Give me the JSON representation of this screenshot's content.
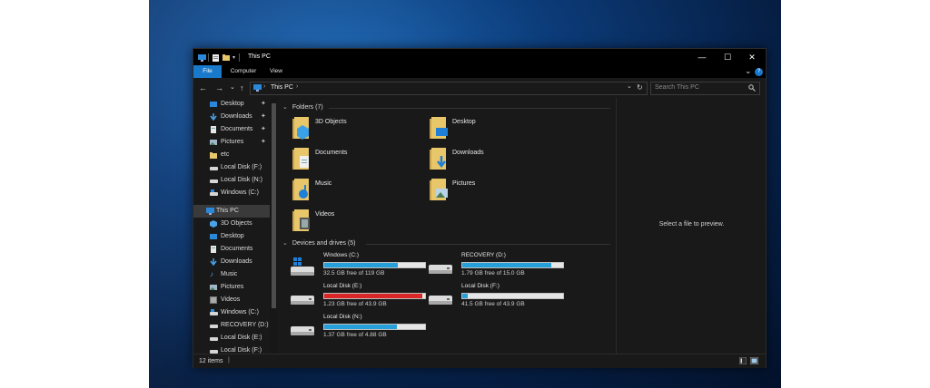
{
  "window": {
    "title": "This PC",
    "controls": {
      "minimize": "—",
      "maximize": "☐",
      "close": "✕"
    },
    "help": "?"
  },
  "quick_access": {
    "dropdown": "▾"
  },
  "ribbon": {
    "tabs": [
      "File",
      "Computer",
      "View"
    ],
    "expand": "⌄"
  },
  "nav": {
    "back": "←",
    "forward": "→",
    "recent": "⌄",
    "up": "↑",
    "address": {
      "crumb": "This PC",
      "sep1": "›",
      "sep2": "›"
    },
    "dropdown": "⌄",
    "refresh": "↻",
    "search_placeholder": "Search This PC"
  },
  "sidebar": {
    "quick": [
      {
        "label": "Desktop",
        "pinned": true
      },
      {
        "label": "Downloads",
        "pinned": true
      },
      {
        "label": "Documents",
        "pinned": true
      },
      {
        "label": "Pictures",
        "pinned": true
      },
      {
        "label": "etc",
        "pinned": false
      },
      {
        "label": "Local Disk (F:)",
        "pinned": false
      },
      {
        "label": "Local Disk (N:)",
        "pinned": false
      },
      {
        "label": "Windows (C:)",
        "pinned": false
      }
    ],
    "this_pc": "This PC",
    "pc_items": [
      "3D Objects",
      "Desktop",
      "Documents",
      "Downloads",
      "Music",
      "Pictures",
      "Videos",
      "Windows (C:)",
      "RECOVERY (D:)",
      "Local Disk (E:)",
      "Local Disk (F:)"
    ],
    "pin_glyph": "📌"
  },
  "folders": {
    "header": "Folders (7)",
    "items": [
      "3D Objects",
      "Desktop",
      "Documents",
      "Downloads",
      "Music",
      "Pictures",
      "Videos"
    ]
  },
  "drives": {
    "header": "Devices and drives (5)",
    "items": [
      {
        "name": "Windows (C:)",
        "free": "32.5 GB free of 119 GB",
        "used_fraction": 0.73,
        "color": "#26a0da"
      },
      {
        "name": "RECOVERY (D:)",
        "free": "1.79 GB free of 15.0 GB",
        "used_fraction": 0.88,
        "color": "#26a0da"
      },
      {
        "name": "Local Disk (E:)",
        "free": "1.23 GB free of 43.9 GB",
        "used_fraction": 0.97,
        "color": "#da2626"
      },
      {
        "name": "Local Disk (F:)",
        "free": "41.5 GB free of 43.9 GB",
        "used_fraction": 0.05,
        "color": "#26a0da"
      },
      {
        "name": "Local Disk (N:)",
        "free": "1.37 GB free of 4.88 GB",
        "used_fraction": 0.72,
        "color": "#26a0da"
      }
    ]
  },
  "preview_text": "Select a file to preview.",
  "status": {
    "items": "12 items",
    "sep": "|"
  },
  "colors": {
    "accent": "#1979ca",
    "folder": "#e8c66a",
    "drive_bar_normal": "#26a0da",
    "drive_bar_full": "#da2626"
  }
}
